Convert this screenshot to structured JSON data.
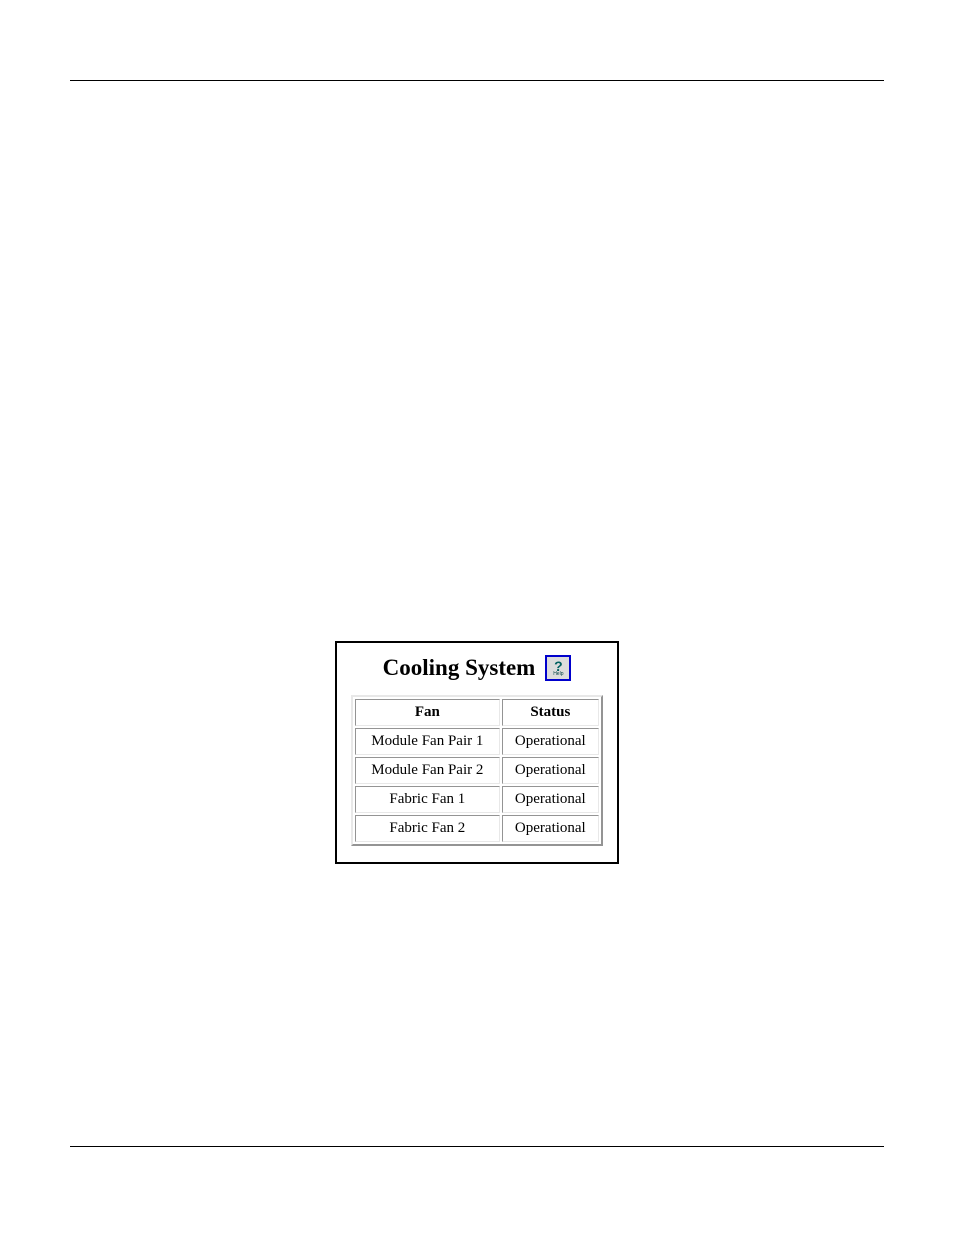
{
  "panel": {
    "title": "Cooling System",
    "help_glyph": "?",
    "help_label": "Help"
  },
  "table": {
    "headers": {
      "fan": "Fan",
      "status": "Status"
    },
    "rows": [
      {
        "fan": "Module Fan Pair 1",
        "status": "Operational"
      },
      {
        "fan": "Module Fan Pair 2",
        "status": "Operational"
      },
      {
        "fan": "Fabric Fan 1",
        "status": "Operational"
      },
      {
        "fan": "Fabric Fan 2",
        "status": "Operational"
      }
    ]
  }
}
